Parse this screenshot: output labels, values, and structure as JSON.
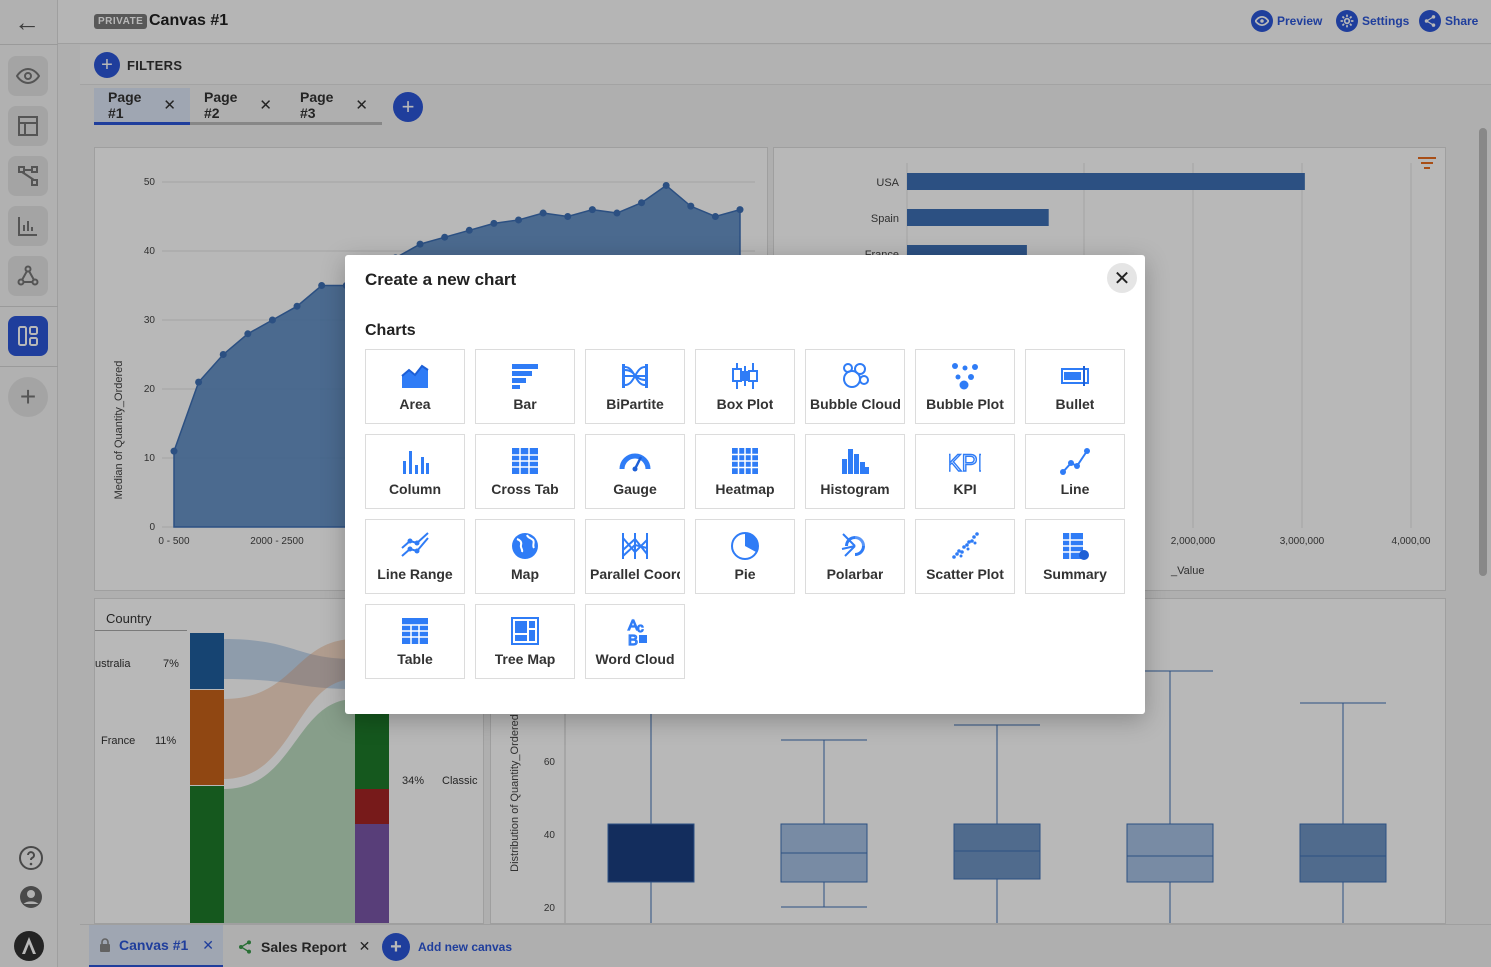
{
  "topbar": {
    "badge": "PRIVATE",
    "canvas_title": "Canvas #1",
    "preview_label": "Preview",
    "settings_label": "Settings",
    "share_label": "Share"
  },
  "filters": {
    "label": "FILTERS"
  },
  "pages": [
    {
      "label": "Page #1",
      "active": true
    },
    {
      "label": "Page #2",
      "active": false
    },
    {
      "label": "Page #3",
      "active": false
    }
  ],
  "background_charts": {
    "area": {
      "ylabel": "Median of Quantity_Ordered",
      "yticks": [
        "50",
        "40",
        "30",
        "20",
        "10",
        "0"
      ],
      "xticks": [
        "0 - 500",
        "2000 - 2500"
      ],
      "values": [
        11,
        21,
        25,
        28,
        30,
        32,
        35,
        35,
        37,
        39,
        41,
        42,
        43,
        44,
        44.5,
        45.5,
        45,
        46,
        45.5,
        47,
        49.5,
        46.5,
        45,
        46
      ]
    },
    "bar": {
      "categories": [
        "USA",
        "Spain",
        "France"
      ],
      "values": [
        3650000,
        1300000,
        1100000
      ],
      "xticks": [
        "2,000,000",
        "3,000,000",
        "4,000,00"
      ],
      "xlabel": "_Value"
    },
    "sankey": {
      "header": "Country",
      "rows": [
        {
          "label": "ustralia",
          "pct": "7%"
        },
        {
          "label": "France",
          "pct": "11%"
        }
      ],
      "right_pct": "34%",
      "right_label": "Classic"
    },
    "boxplot": {
      "ylabel": "Distribution of Quantity_Ordered",
      "yticks": [
        "60",
        "40",
        "20"
      ]
    }
  },
  "modal": {
    "title": "Create a new chart",
    "section": "Charts",
    "charts": [
      {
        "label": "Area",
        "icon": "area-chart-icon"
      },
      {
        "label": "Bar",
        "icon": "bar-chart-icon"
      },
      {
        "label": "BiPartite",
        "icon": "bipartite-chart-icon"
      },
      {
        "label": "Box Plot",
        "icon": "box-plot-icon"
      },
      {
        "label": "Bubble Cloud",
        "icon": "bubble-cloud-icon"
      },
      {
        "label": "Bubble Plot",
        "icon": "bubble-plot-icon"
      },
      {
        "label": "Bullet",
        "icon": "bullet-chart-icon"
      },
      {
        "label": "Column",
        "icon": "column-chart-icon"
      },
      {
        "label": "Cross Tab",
        "icon": "cross-tab-icon"
      },
      {
        "label": "Gauge",
        "icon": "gauge-icon"
      },
      {
        "label": "Heatmap",
        "icon": "heatmap-icon"
      },
      {
        "label": "Histogram",
        "icon": "histogram-icon"
      },
      {
        "label": "KPI",
        "icon": "kpi-icon"
      },
      {
        "label": "Line",
        "icon": "line-chart-icon"
      },
      {
        "label": "Line Range",
        "icon": "line-range-icon"
      },
      {
        "label": "Map",
        "icon": "map-icon"
      },
      {
        "label": "Parallel Coordinates",
        "icon": "parallel-coordinates-icon"
      },
      {
        "label": "Pie",
        "icon": "pie-chart-icon"
      },
      {
        "label": "Polarbar",
        "icon": "polarbar-icon"
      },
      {
        "label": "Scatter Plot",
        "icon": "scatter-plot-icon"
      },
      {
        "label": "Summary",
        "icon": "summary-icon"
      },
      {
        "label": "Table",
        "icon": "table-icon"
      },
      {
        "label": "Tree Map",
        "icon": "tree-map-icon"
      },
      {
        "label": "Word Cloud",
        "icon": "word-cloud-icon"
      }
    ]
  },
  "bottom": {
    "canvas_tabs": [
      {
        "label": "Canvas #1",
        "active": true
      },
      {
        "label": "Sales Report",
        "active": false
      }
    ],
    "add_label": "Add new canvas"
  },
  "colors": {
    "accent": "#2c56d8",
    "icon_blue": "#2f7cf6",
    "area_fill": "#4f81bd",
    "bar_fill": "#3d6fb5"
  }
}
